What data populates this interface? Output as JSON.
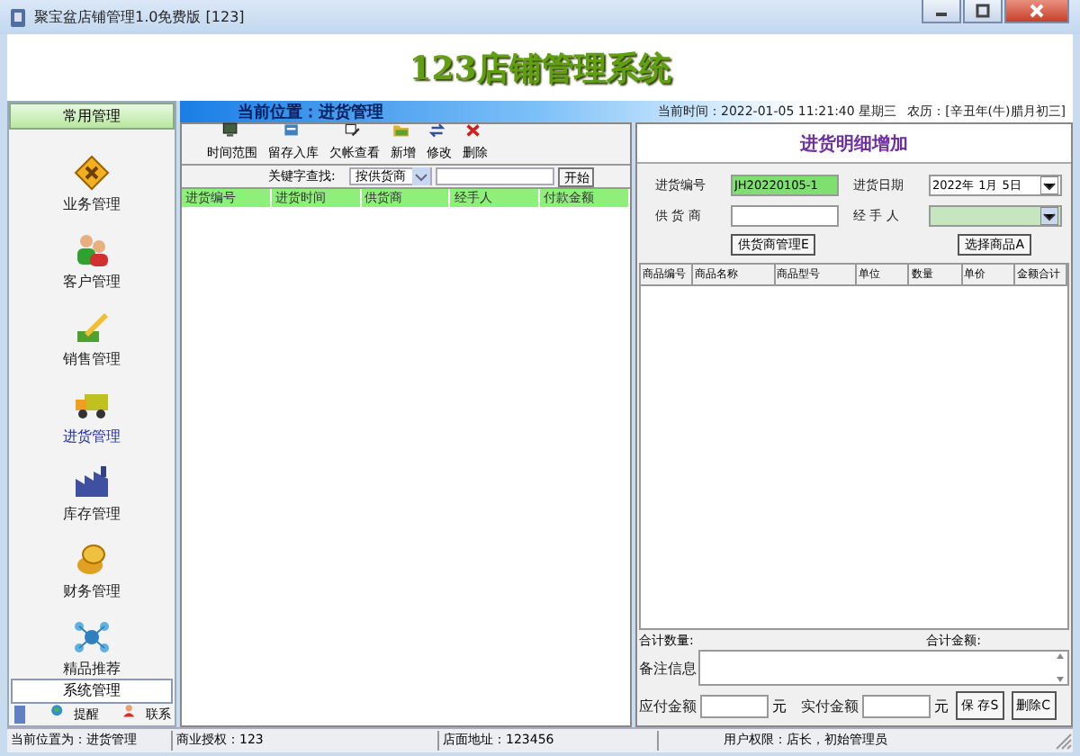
{
  "window": {
    "title": "聚宝盆店铺管理1.0免费版 [123]"
  },
  "header": {
    "title": "123店铺管理系统"
  },
  "sidebar": {
    "header": "常用管理",
    "items": [
      {
        "label": "业务管理",
        "selected": false
      },
      {
        "label": "客户管理",
        "selected": false
      },
      {
        "label": "销售管理",
        "selected": false
      },
      {
        "label": "进货管理",
        "selected": true
      },
      {
        "label": "库存管理",
        "selected": false
      },
      {
        "label": "财务管理",
        "selected": false
      },
      {
        "label": "精品推荐",
        "selected": false
      }
    ],
    "footer": "系统管理",
    "links": [
      {
        "label": "提醒"
      },
      {
        "label": "联系"
      }
    ]
  },
  "location": {
    "label": "当前位置：进货管理",
    "time": "当前时间：2022-01-05 11:21:40 星期三",
    "lunar": "农历：[辛丑年(牛)腊月初三]"
  },
  "toolbar": [
    {
      "label": "时间范围"
    },
    {
      "label": "留存入库"
    },
    {
      "label": "欠帐查看"
    },
    {
      "label": "新增"
    },
    {
      "label": "修改"
    },
    {
      "label": "删除"
    }
  ],
  "search": {
    "label": "关键字查找:",
    "field": "按供货商",
    "button": "开始"
  },
  "list": {
    "columns": [
      "进货编号",
      "进货时间",
      "供货商",
      "经手人",
      "付款金额"
    ]
  },
  "detail": {
    "title": "进货明细增加",
    "fields": [
      {
        "label": "进货编号",
        "value": "JH20220105-1",
        "kind": "text",
        "highlight": true
      },
      {
        "label": "进货日期",
        "value": "2022年 1月 5日",
        "kind": "combo",
        "highlight": false
      },
      {
        "label": "供 货 商",
        "kind": "text",
        "highlight": false
      },
      {
        "label": "经 手 人",
        "kind": "combo",
        "highlight": true
      }
    ],
    "buttons": [
      "供货商管理E",
      "选择商品A"
    ],
    "columns": [
      "商品编号",
      "商品名称",
      "商品型号",
      "单位",
      "数量",
      "单价",
      "金额合计"
    ],
    "total_qty": "合计数量:",
    "total_amount": "合计金额:",
    "note": "备注信息",
    "payable": "应付金额",
    "payable_unit": "元",
    "paid": "实付金额",
    "paid_unit": "元",
    "actions": [
      "保 存S",
      "删除C"
    ]
  },
  "status_bar": [
    "当前位置为：进货管理",
    "商业授权：123",
    "店面地址：123456",
    "用户权限：店长，初始管理员"
  ]
}
